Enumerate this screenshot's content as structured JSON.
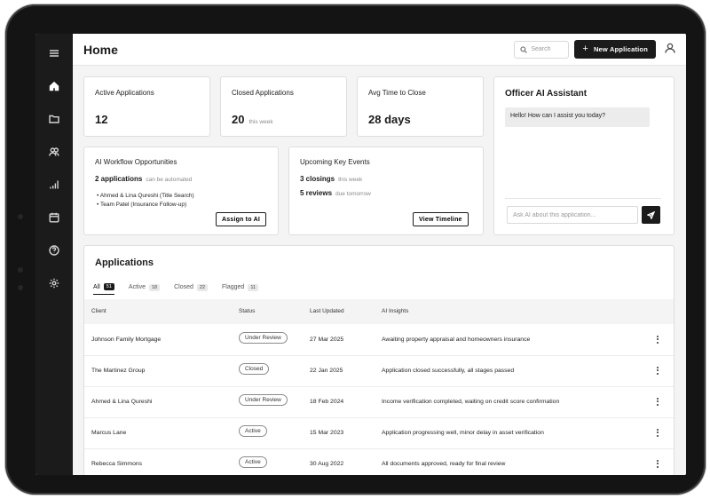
{
  "header": {
    "title": "Home",
    "search_placeholder": "Search",
    "new_button": "New Application"
  },
  "stats": {
    "active": {
      "label": "Active Applications",
      "value": "12"
    },
    "closed": {
      "label": "Closed Applications",
      "value": "20",
      "sub": "this week"
    },
    "avg": {
      "label": "Avg Time to Close",
      "value": "28 days"
    }
  },
  "workflow": {
    "title": "AI Workflow Opportunities",
    "count": "2 applications",
    "count_sub": "can be automated",
    "items": [
      "Ahmed & Lina Qureshi (Title Search)",
      "Team Patel (Insurance Follow-up)"
    ],
    "button": "Assign to AI"
  },
  "events": {
    "title": "Upcoming Key Events",
    "closings": "3 closings",
    "closings_sub": "this week",
    "reviews": "5 reviews",
    "reviews_sub": "due tomorrow",
    "button": "View Timeline"
  },
  "assistant": {
    "title": "Officer AI Assistant",
    "greeting": "Hello! How can I assist you today?",
    "input_placeholder": "Ask AI about this application..."
  },
  "applications": {
    "title": "Applications",
    "tabs": [
      {
        "label": "All",
        "count": "51"
      },
      {
        "label": "Active",
        "count": "18"
      },
      {
        "label": "Closed",
        "count": "22"
      },
      {
        "label": "Flagged",
        "count": "11"
      }
    ],
    "columns": [
      "Client",
      "Status",
      "Last Updated",
      "AI Insights"
    ],
    "rows": [
      {
        "client": "Johnson Family Mortgage",
        "status": "Under Review",
        "updated": "27 Mar 2025",
        "insight": "Awaiting property appraisal and homeowners insurance"
      },
      {
        "client": "The Martinez Group",
        "status": "Closed",
        "updated": "22 Jan 2025",
        "insight": "Application closed successfully, all stages passed"
      },
      {
        "client": "Ahmed & Lina Qureshi",
        "status": "Under Review",
        "updated": "18 Feb 2024",
        "insight": "Income verification completed, waiting on credit score confirmation"
      },
      {
        "client": "Marcus Lane",
        "status": "Active",
        "updated": "15 Mar 2023",
        "insight": "Application progressing well, minor delay in asset verification"
      },
      {
        "client": "Rebecca Simmons",
        "status": "Active",
        "updated": "30 Aug 2022",
        "insight": "All documents approved, ready for final review"
      }
    ]
  },
  "sidebar": {
    "icons": [
      "menu-icon",
      "home-icon",
      "folder-icon",
      "users-icon",
      "bar-chart-icon",
      "calendar-icon",
      "help-icon",
      "settings-icon"
    ]
  }
}
